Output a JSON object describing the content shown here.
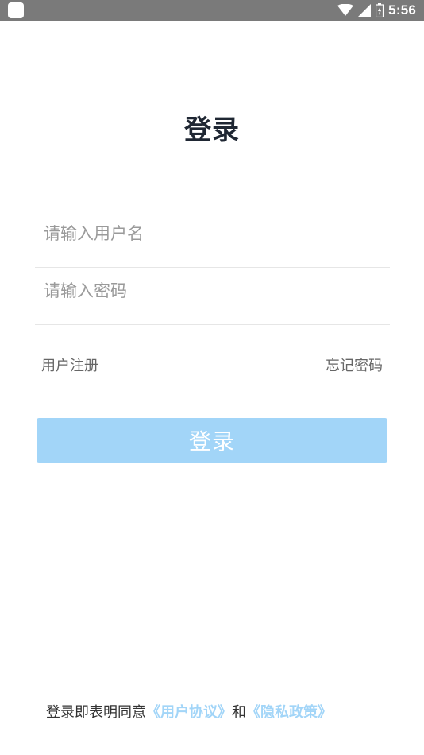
{
  "status_bar": {
    "time": "5:56",
    "icons": [
      "app-square-icon",
      "wifi-icon",
      "signal-icon",
      "battery-icon"
    ]
  },
  "login": {
    "title": "登录",
    "username_placeholder": "请输入用户名",
    "password_placeholder": "请输入密码",
    "register_label": "用户注册",
    "forgot_label": "忘记密码",
    "submit_label": "登录"
  },
  "agreement": {
    "prefix": "登录即表明同意",
    "user_agreement": "《用户协议》",
    "and": "和",
    "privacy_policy": "《隐私政策》"
  },
  "colors": {
    "status_bar": "#7a7a7a",
    "title": "#1f2733",
    "button": "#a2d5f8",
    "link_accent": "#a2d5f8",
    "secondary_text": "#666666"
  }
}
